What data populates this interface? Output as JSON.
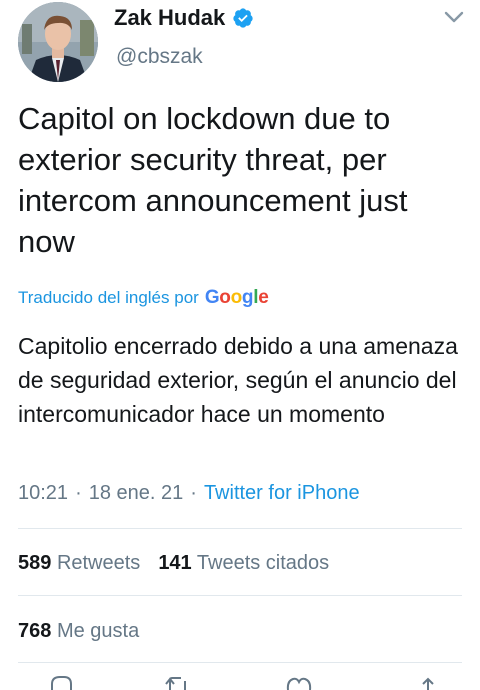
{
  "author": {
    "name": "Zak Hudak",
    "handle": "@cbszak",
    "verified": true
  },
  "tweet": {
    "text": "Capitol on lockdown due to exterior security threat, per intercom announcement just now",
    "translated_by": "Traducido del inglés por",
    "translator_logo": "Google",
    "translation": "Capitolio encerrado debido a una amenaza de seguridad exterior, según el anuncio del intercomunicador hace un momento",
    "time": "10:21",
    "date": "18 ene. 21",
    "source": "Twitter for iPhone"
  },
  "stats": {
    "retweets_count": "589",
    "retweets_label": "Retweets",
    "quotes_count": "141",
    "quotes_label": "Tweets citados",
    "likes_count": "768",
    "likes_label": "Me gusta"
  },
  "colors": {
    "accent": "#1b95e0",
    "muted": "#657786",
    "text": "#14171a",
    "divider": "#e1e8ed",
    "verified": "#1da1f2"
  },
  "icons": [
    "verified-badge-icon",
    "chevron-down-icon",
    "reply-icon",
    "retweet-icon",
    "like-icon",
    "share-icon"
  ]
}
